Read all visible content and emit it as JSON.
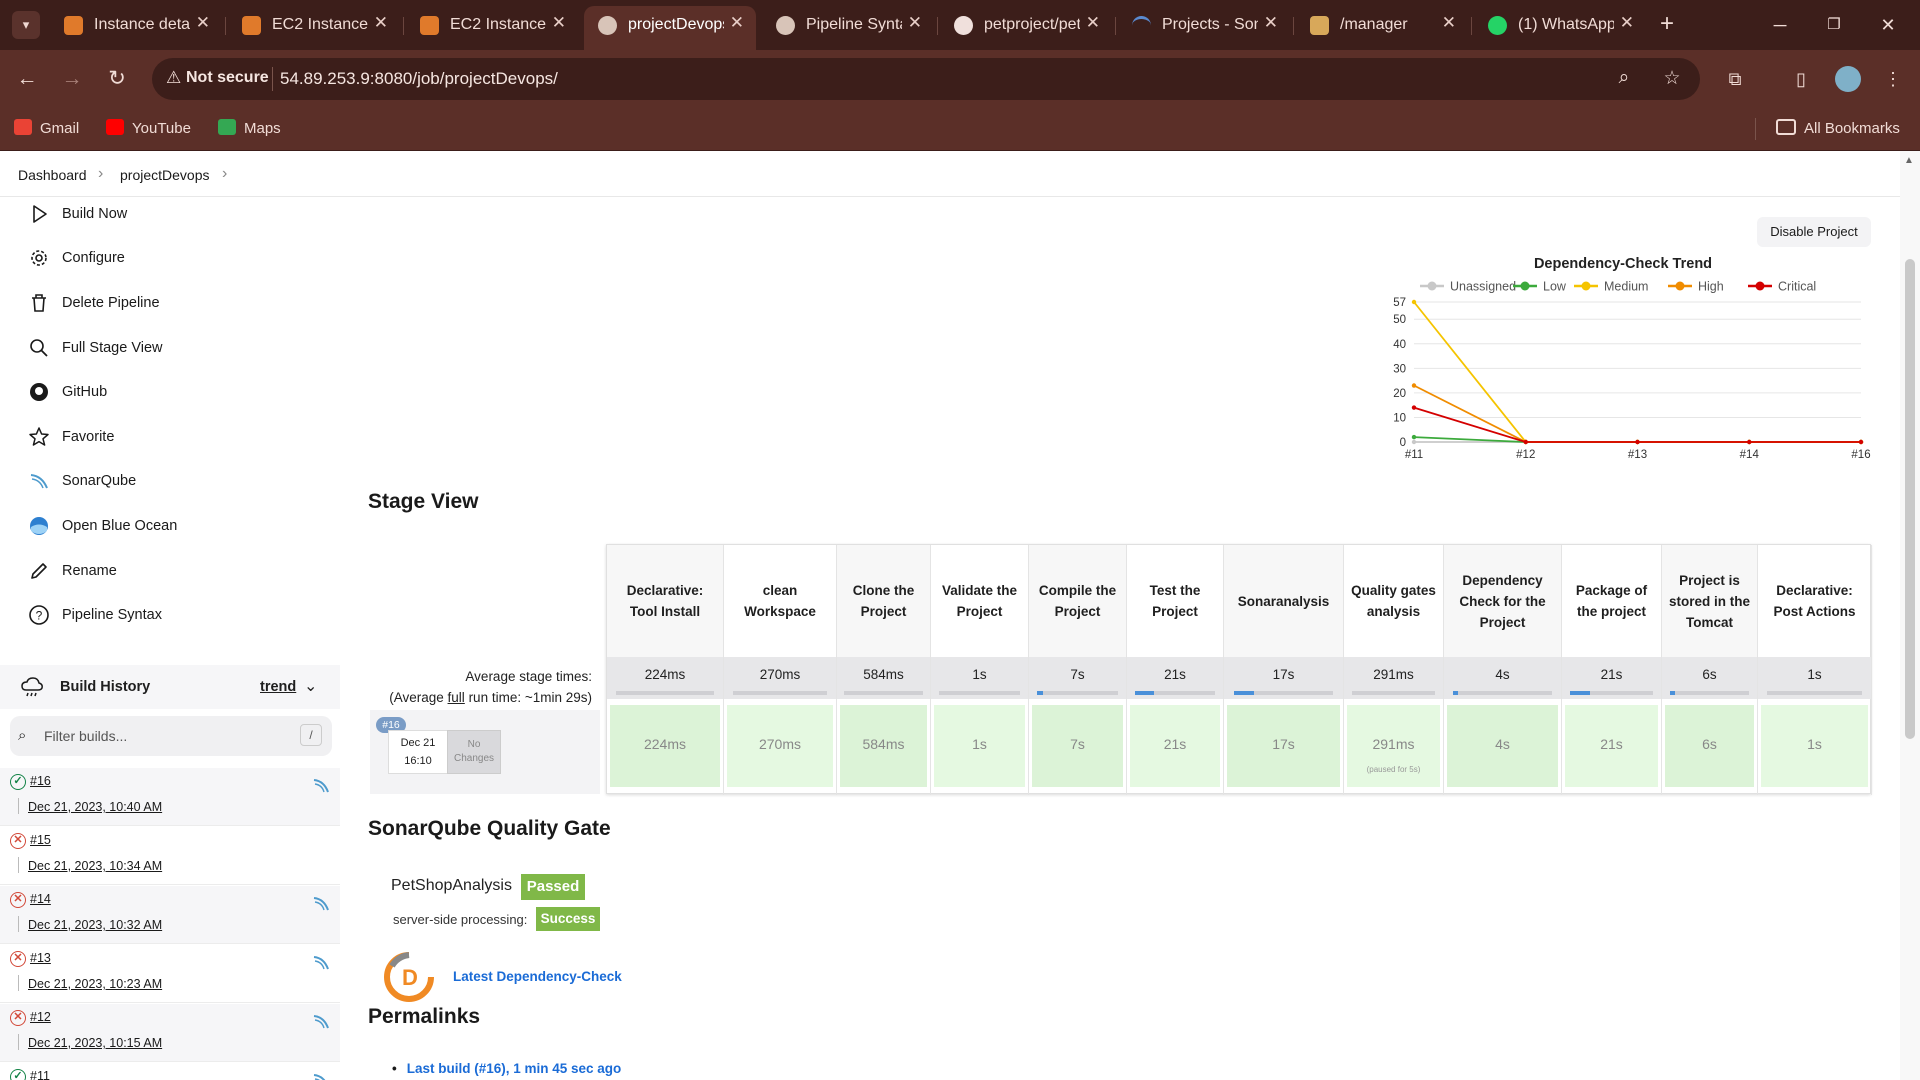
{
  "browser": {
    "tabs": [
      {
        "title": "Instance details",
        "color": "#e07a2b"
      },
      {
        "title": "EC2 Instance",
        "color": "#e07a2b"
      },
      {
        "title": "EC2 Instance",
        "color": "#e07a2b"
      },
      {
        "title": "projectDevops",
        "color": "#d8c4b8",
        "active": true
      },
      {
        "title": "Pipeline Syntax",
        "color": "#d8c4b8"
      },
      {
        "title": "petproject/pet",
        "color": "#f0e0dc"
      },
      {
        "title": "Projects - SonarQube",
        "color": "#5a8ad0"
      },
      {
        "title": "/manager",
        "color": "#d8a85a"
      },
      {
        "title": "(1) WhatsApp",
        "color": "#25d366"
      }
    ],
    "address": {
      "security_label": "Not secure",
      "url": "54.89.253.9:8080/job/projectDevops/"
    },
    "bookmarks": [
      {
        "label": "Gmail",
        "color": "#ea4335"
      },
      {
        "label": "YouTube",
        "color": "#ff0000"
      },
      {
        "label": "Maps",
        "color": "#34a853"
      }
    ],
    "all_bookmarks": "All Bookmarks"
  },
  "breadcrumb": {
    "items": [
      "Dashboard",
      "projectDevops"
    ]
  },
  "sidebar": {
    "items": [
      {
        "label": "Build Now",
        "icon": "play-icon"
      },
      {
        "label": "Configure",
        "icon": "gear-icon"
      },
      {
        "label": "Delete Pipeline",
        "icon": "trash-icon"
      },
      {
        "label": "Full Stage View",
        "icon": "search-icon"
      },
      {
        "label": "GitHub",
        "icon": "github-icon"
      },
      {
        "label": "Favorite",
        "icon": "star-icon"
      },
      {
        "label": "SonarQube",
        "icon": "sonarqube-icon"
      },
      {
        "label": "Open Blue Ocean",
        "icon": "blue-ocean-icon"
      },
      {
        "label": "Rename",
        "icon": "pencil-icon"
      },
      {
        "label": "Pipeline Syntax",
        "icon": "help-icon"
      }
    ],
    "build_history": {
      "title": "Build History",
      "trend_label": "trend",
      "filter_placeholder": "Filter builds...",
      "filter_shortcut": "/",
      "builds": [
        {
          "number": "#16",
          "date": "Dec 21, 2023, 10:40 AM",
          "status": "success",
          "sonar": true
        },
        {
          "number": "#15",
          "date": "Dec 21, 2023, 10:34 AM",
          "status": "failed",
          "sonar": false
        },
        {
          "number": "#14",
          "date": "Dec 21, 2023, 10:32 AM",
          "status": "failed",
          "sonar": true
        },
        {
          "number": "#13",
          "date": "Dec 21, 2023, 10:23 AM",
          "status": "failed",
          "sonar": true
        },
        {
          "number": "#12",
          "date": "Dec 21, 2023, 10:15 AM",
          "status": "failed",
          "sonar": true
        },
        {
          "number": "#11",
          "date": "",
          "status": "success",
          "sonar": true
        }
      ]
    }
  },
  "main": {
    "disable_button": "Disable Project",
    "stage_view_title": "Stage View",
    "avg_label_line1": "Average stage times:",
    "avg_label_line2_pre": "(Average ",
    "avg_label_line2_link": "full",
    "avg_label_line2_post": " run time: ~1min 29s)",
    "run": {
      "badge": "#16",
      "date": "Dec 21",
      "time": "16:10",
      "changes": "No Changes"
    },
    "stages": [
      {
        "name": "Declarative: Tool Install",
        "avg": "224ms",
        "cell": "224ms",
        "progress": 0
      },
      {
        "name": "clean Workspace",
        "avg": "270ms",
        "cell": "270ms",
        "progress": 0
      },
      {
        "name": "Clone the Project",
        "avg": "584ms",
        "cell": "584ms",
        "progress": 0
      },
      {
        "name": "Validate the Project",
        "avg": "1s",
        "cell": "1s",
        "progress": 0
      },
      {
        "name": "Compile the Project",
        "avg": "7s",
        "cell": "7s",
        "progress": 0.08
      },
      {
        "name": "Test the Project",
        "avg": "21s",
        "cell": "21s",
        "progress": 0.24
      },
      {
        "name": "Sonaranalysis",
        "avg": "17s",
        "cell": "17s",
        "progress": 0.2
      },
      {
        "name": "Quality gates analysis",
        "avg": "291ms",
        "cell": "291ms",
        "note": "(paused for 5s)",
        "progress": 0
      },
      {
        "name": "Dependency Check for the Project",
        "avg": "4s",
        "cell": "4s",
        "progress": 0.05
      },
      {
        "name": "Package of the project",
        "avg": "21s",
        "cell": "21s",
        "progress": 0.24
      },
      {
        "name": "Project is stored in the Tomcat",
        "avg": "6s",
        "cell": "6s",
        "progress": 0.07
      },
      {
        "name": "Declarative: Post Actions",
        "avg": "1s",
        "cell": "1s",
        "progress": 0
      }
    ],
    "sonar": {
      "title": "SonarQube Quality Gate",
      "project": "PetShopAnalysis",
      "status": "Passed",
      "processing_label": "server-side processing:",
      "processing_status": "Success"
    },
    "dependency_check_link": "Latest Dependency-Check",
    "permalinks": {
      "title": "Permalinks",
      "items": [
        "Last build (#16), 1 min 45 sec ago"
      ]
    }
  },
  "chart_data": {
    "type": "line",
    "title": "Dependency-Check Trend",
    "categories": [
      "#11",
      "#12",
      "#13",
      "#14",
      "#16"
    ],
    "yticks": [
      0,
      10,
      20,
      30,
      40,
      50,
      57
    ],
    "ylim": [
      0,
      57
    ],
    "legend_position": "top",
    "series": [
      {
        "name": "Unassigned",
        "color": "#c8c8c8",
        "values": [
          0,
          0,
          0,
          0,
          0
        ]
      },
      {
        "name": "Low",
        "color": "#3caa3c",
        "values": [
          2,
          0,
          0,
          0,
          0
        ]
      },
      {
        "name": "Medium",
        "color": "#f5c400",
        "values": [
          57,
          0,
          0,
          0,
          0
        ]
      },
      {
        "name": "High",
        "color": "#f08c00",
        "values": [
          23,
          0,
          0,
          0,
          0
        ]
      },
      {
        "name": "Critical",
        "color": "#d40000",
        "values": [
          14,
          0,
          0,
          0,
          0
        ]
      }
    ]
  }
}
